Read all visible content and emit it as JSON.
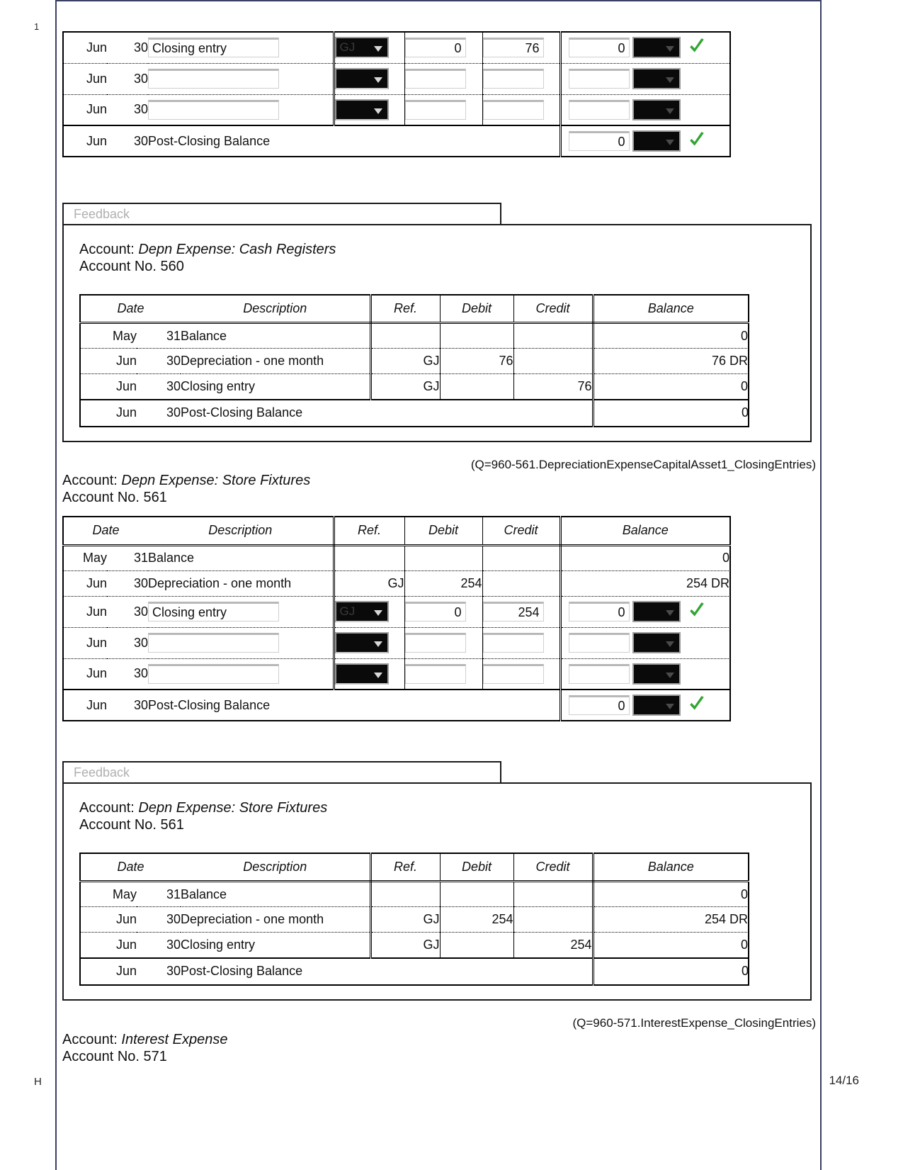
{
  "page": {
    "margin_number_top": "1",
    "margin_number_bottom": "H",
    "footer": "14/16"
  },
  "top_worksheet": {
    "rows": [
      {
        "month": "Jun",
        "day": "30",
        "description_value": "Closing entry",
        "ref_value": "GJ",
        "debit_value": "0",
        "credit_value": "76",
        "balance_value": "0",
        "checked": true
      },
      {
        "month": "Jun",
        "day": "30",
        "description_value": "",
        "ref_value": "",
        "debit_value": "",
        "credit_value": "",
        "balance_value": "",
        "checked": false
      },
      {
        "month": "Jun",
        "day": "30",
        "description_value": "",
        "ref_value": "",
        "debit_value": "",
        "credit_value": "",
        "balance_value": "",
        "checked": false
      }
    ],
    "post_closing": {
      "month": "Jun",
      "day": "30",
      "label": "Post-Closing Balance",
      "balance_value": "0",
      "checked": true
    }
  },
  "feedback_560": {
    "tab_label": "Feedback",
    "account_label": "Account:",
    "account_name": "Depn Expense: Cash Registers",
    "account_no_label": "Account No.",
    "account_no": "560",
    "columns": [
      "Date",
      "Description",
      "Ref.",
      "Debit",
      "Credit",
      "Balance"
    ],
    "rows": [
      {
        "month": "May",
        "day": "31",
        "description": "Balance",
        "ref": "",
        "debit": "",
        "credit": "",
        "balance": "0"
      },
      {
        "month": "Jun",
        "day": "30",
        "description": "Depreciation - one month",
        "ref": "GJ",
        "debit": "76",
        "credit": "",
        "balance": "76 DR"
      },
      {
        "month": "Jun",
        "day": "30",
        "description": "Closing entry",
        "ref": "GJ",
        "debit": "",
        "credit": "76",
        "balance": "0"
      }
    ],
    "post_closing": {
      "month": "Jun",
      "day": "30",
      "label": "Post-Closing Balance",
      "balance": "0"
    }
  },
  "qid_561": "(Q=960-561.DepreciationExpenseCapitalAsset1_ClosingEntries)",
  "worksheet_561": {
    "account_label": "Account:",
    "account_name": "Depn Expense: Store Fixtures",
    "account_no_label": "Account No.",
    "account_no": "561",
    "columns": [
      "Date",
      "Description",
      "Ref.",
      "Debit",
      "Credit",
      "Balance"
    ],
    "static_rows": [
      {
        "month": "May",
        "day": "31",
        "description": "Balance",
        "ref": "",
        "debit": "",
        "credit": "",
        "balance": "0"
      },
      {
        "month": "Jun",
        "day": "30",
        "description": "Depreciation - one month",
        "ref": "GJ",
        "debit": "254",
        "credit": "",
        "balance": "254 DR"
      }
    ],
    "input_rows": [
      {
        "month": "Jun",
        "day": "30",
        "description_value": "Closing entry",
        "ref_value": "GJ",
        "debit_value": "0",
        "credit_value": "254",
        "balance_value": "0",
        "checked": true
      },
      {
        "month": "Jun",
        "day": "30",
        "description_value": "",
        "ref_value": "",
        "debit_value": "",
        "credit_value": "",
        "balance_value": "",
        "checked": false
      },
      {
        "month": "Jun",
        "day": "30",
        "description_value": "",
        "ref_value": "",
        "debit_value": "",
        "credit_value": "",
        "balance_value": "",
        "checked": false
      }
    ],
    "post_closing": {
      "month": "Jun",
      "day": "30",
      "label": "Post-Closing Balance",
      "balance_value": "0",
      "checked": true
    }
  },
  "feedback_561": {
    "tab_label": "Feedback",
    "account_label": "Account:",
    "account_name": "Depn Expense: Store Fixtures",
    "account_no_label": "Account No.",
    "account_no": "561",
    "columns": [
      "Date",
      "Description",
      "Ref.",
      "Debit",
      "Credit",
      "Balance"
    ],
    "rows": [
      {
        "month": "May",
        "day": "31",
        "description": "Balance",
        "ref": "",
        "debit": "",
        "credit": "",
        "balance": "0"
      },
      {
        "month": "Jun",
        "day": "30",
        "description": "Depreciation - one month",
        "ref": "GJ",
        "debit": "254",
        "credit": "",
        "balance": "254 DR"
      },
      {
        "month": "Jun",
        "day": "30",
        "description": "Closing entry",
        "ref": "GJ",
        "debit": "",
        "credit": "254",
        "balance": "0"
      }
    ],
    "post_closing": {
      "month": "Jun",
      "day": "30",
      "label": "Post-Closing Balance",
      "balance": "0"
    }
  },
  "qid_571": "(Q=960-571.InterestExpense_ClosingEntries)",
  "account_571": {
    "account_label": "Account:",
    "account_name": "Interest Expense",
    "account_no_label": "Account No.",
    "account_no": "571"
  },
  "colors": {
    "check_green": "#33a532",
    "header_gray": "#a9a9a9",
    "frame_blue": "#3b3f63"
  }
}
